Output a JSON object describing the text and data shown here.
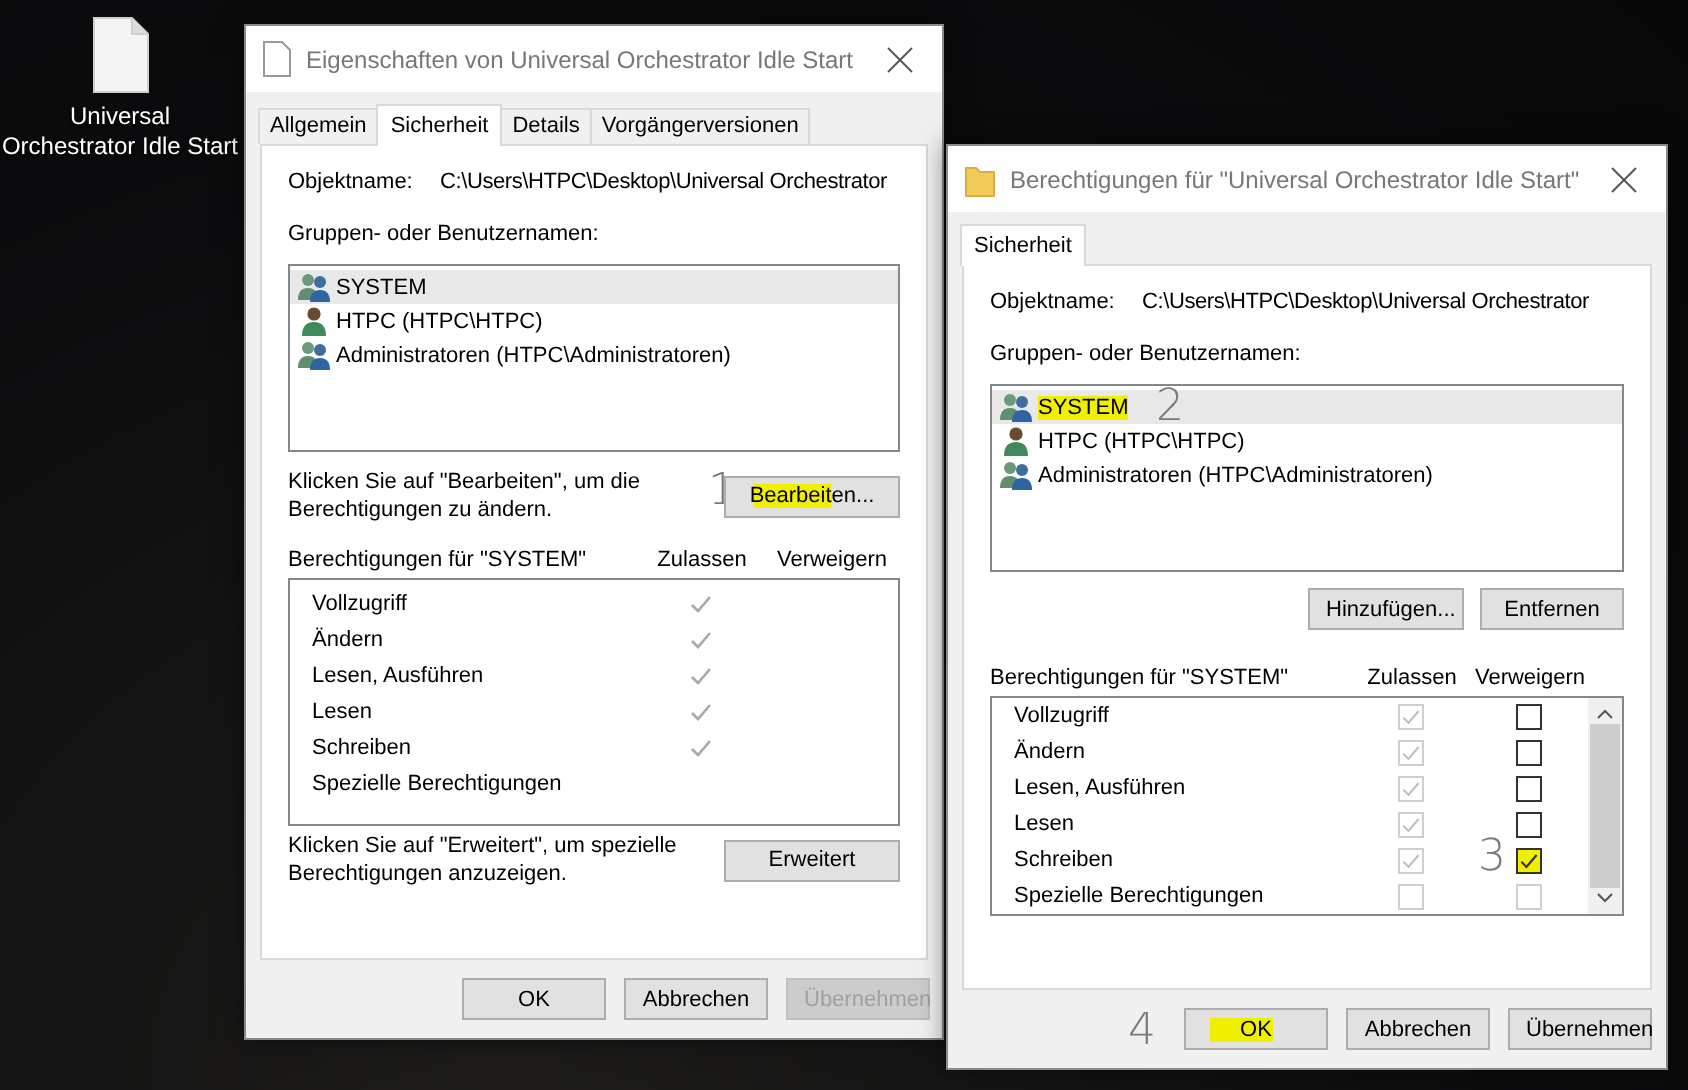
{
  "desktop_icon": {
    "label": "Universal Orchestrator Idle Start"
  },
  "dialogs": [
    {
      "kind": "properties",
      "title": "Eigenschaften von Universal Orchestrator Idle Start",
      "tabs": [
        {
          "label": "Allgemein",
          "selected": false
        },
        {
          "label": "Sicherheit",
          "selected": true
        },
        {
          "label": "Details",
          "selected": false
        },
        {
          "label": "Vorgängerversionen",
          "selected": false
        }
      ],
      "object_label": "Objektname:",
      "object_path": "C:\\Users\\HTPC\\Desktop\\Universal Orchestrator",
      "groups_label": "Gruppen- oder Benutzernamen:",
      "principals": [
        {
          "name": "SYSTEM",
          "kind": "group",
          "selected": true,
          "highlighted": false
        },
        {
          "name": "HTPC (HTPC\\HTPC)",
          "kind": "user",
          "selected": false,
          "highlighted": false
        },
        {
          "name": "Administratoren (HTPC\\Administratoren)",
          "kind": "group",
          "selected": false,
          "highlighted": false
        }
      ],
      "edit_hint": "Klicken Sie auf \"Bearbeiten\", um die Berechtigungen zu ändern.",
      "edit_button": {
        "label": "Bearbeiten...",
        "highlighted": true,
        "annotation": "1"
      },
      "perms_label": "Berechtigungen für \"SYSTEM\"",
      "allow_header": "Zulassen",
      "deny_header": "Verweigern",
      "permissions": [
        {
          "name": "Vollzugriff",
          "allow": true
        },
        {
          "name": "Ändern",
          "allow": true
        },
        {
          "name": "Lesen, Ausführen",
          "allow": true
        },
        {
          "name": "Lesen",
          "allow": true
        },
        {
          "name": "Schreiben",
          "allow": true
        },
        {
          "name": "Spezielle Berechtigungen",
          "allow": false
        }
      ],
      "advanced_hint": "Klicken Sie auf \"Erweitert\", um spezielle Berechtigungen anzuzeigen.",
      "advanced_button": {
        "label": "Erweitert"
      },
      "buttons": [
        {
          "label": "OK",
          "disabled": false,
          "highlighted": false
        },
        {
          "label": "Abbrechen",
          "disabled": false,
          "highlighted": false
        },
        {
          "label": "Übernehmen",
          "disabled": true,
          "highlighted": false
        }
      ]
    },
    {
      "kind": "permissions",
      "title": "Berechtigungen für \"Universal Orchestrator Idle Start\"",
      "tabs": [
        {
          "label": "Sicherheit",
          "selected": true
        }
      ],
      "object_label": "Objektname:",
      "object_path": "C:\\Users\\HTPC\\Desktop\\Universal Orchestrator",
      "groups_label": "Gruppen- oder Benutzernamen:",
      "principals": [
        {
          "name": "SYSTEM",
          "kind": "group",
          "selected": true,
          "highlighted": true,
          "annotation": "2"
        },
        {
          "name": "HTPC (HTPC\\HTPC)",
          "kind": "user",
          "selected": false,
          "highlighted": false
        },
        {
          "name": "Administratoren (HTPC\\Administratoren)",
          "kind": "group",
          "selected": false,
          "highlighted": false
        }
      ],
      "list_buttons": [
        {
          "label": "Hinzufügen..."
        },
        {
          "label": "Entfernen"
        }
      ],
      "perms_label": "Berechtigungen für \"SYSTEM\"",
      "allow_header": "Zulassen",
      "deny_header": "Verweigern",
      "permissions": [
        {
          "name": "Vollzugriff",
          "allow": true,
          "allow_disabled": true,
          "deny": false,
          "deny_disabled": false,
          "highlighted": false
        },
        {
          "name": "Ändern",
          "allow": true,
          "allow_disabled": true,
          "deny": false,
          "deny_disabled": false,
          "highlighted": false
        },
        {
          "name": "Lesen, Ausführen",
          "allow": true,
          "allow_disabled": true,
          "deny": false,
          "deny_disabled": false,
          "highlighted": false
        },
        {
          "name": "Lesen",
          "allow": true,
          "allow_disabled": true,
          "deny": false,
          "deny_disabled": false,
          "highlighted": false
        },
        {
          "name": "Schreiben",
          "allow": true,
          "allow_disabled": true,
          "deny": true,
          "deny_disabled": false,
          "highlighted": true,
          "annotation": "3"
        },
        {
          "name": "Spezielle Berechtigungen",
          "allow": false,
          "allow_disabled": true,
          "deny": false,
          "deny_disabled": true,
          "highlighted": false
        }
      ],
      "buttons": [
        {
          "label": "OK",
          "disabled": false,
          "highlighted": true,
          "annotation": "4"
        },
        {
          "label": "Abbrechen",
          "disabled": false,
          "highlighted": false
        },
        {
          "label": "Übernehmen",
          "disabled": false,
          "highlighted": false
        }
      ]
    }
  ]
}
